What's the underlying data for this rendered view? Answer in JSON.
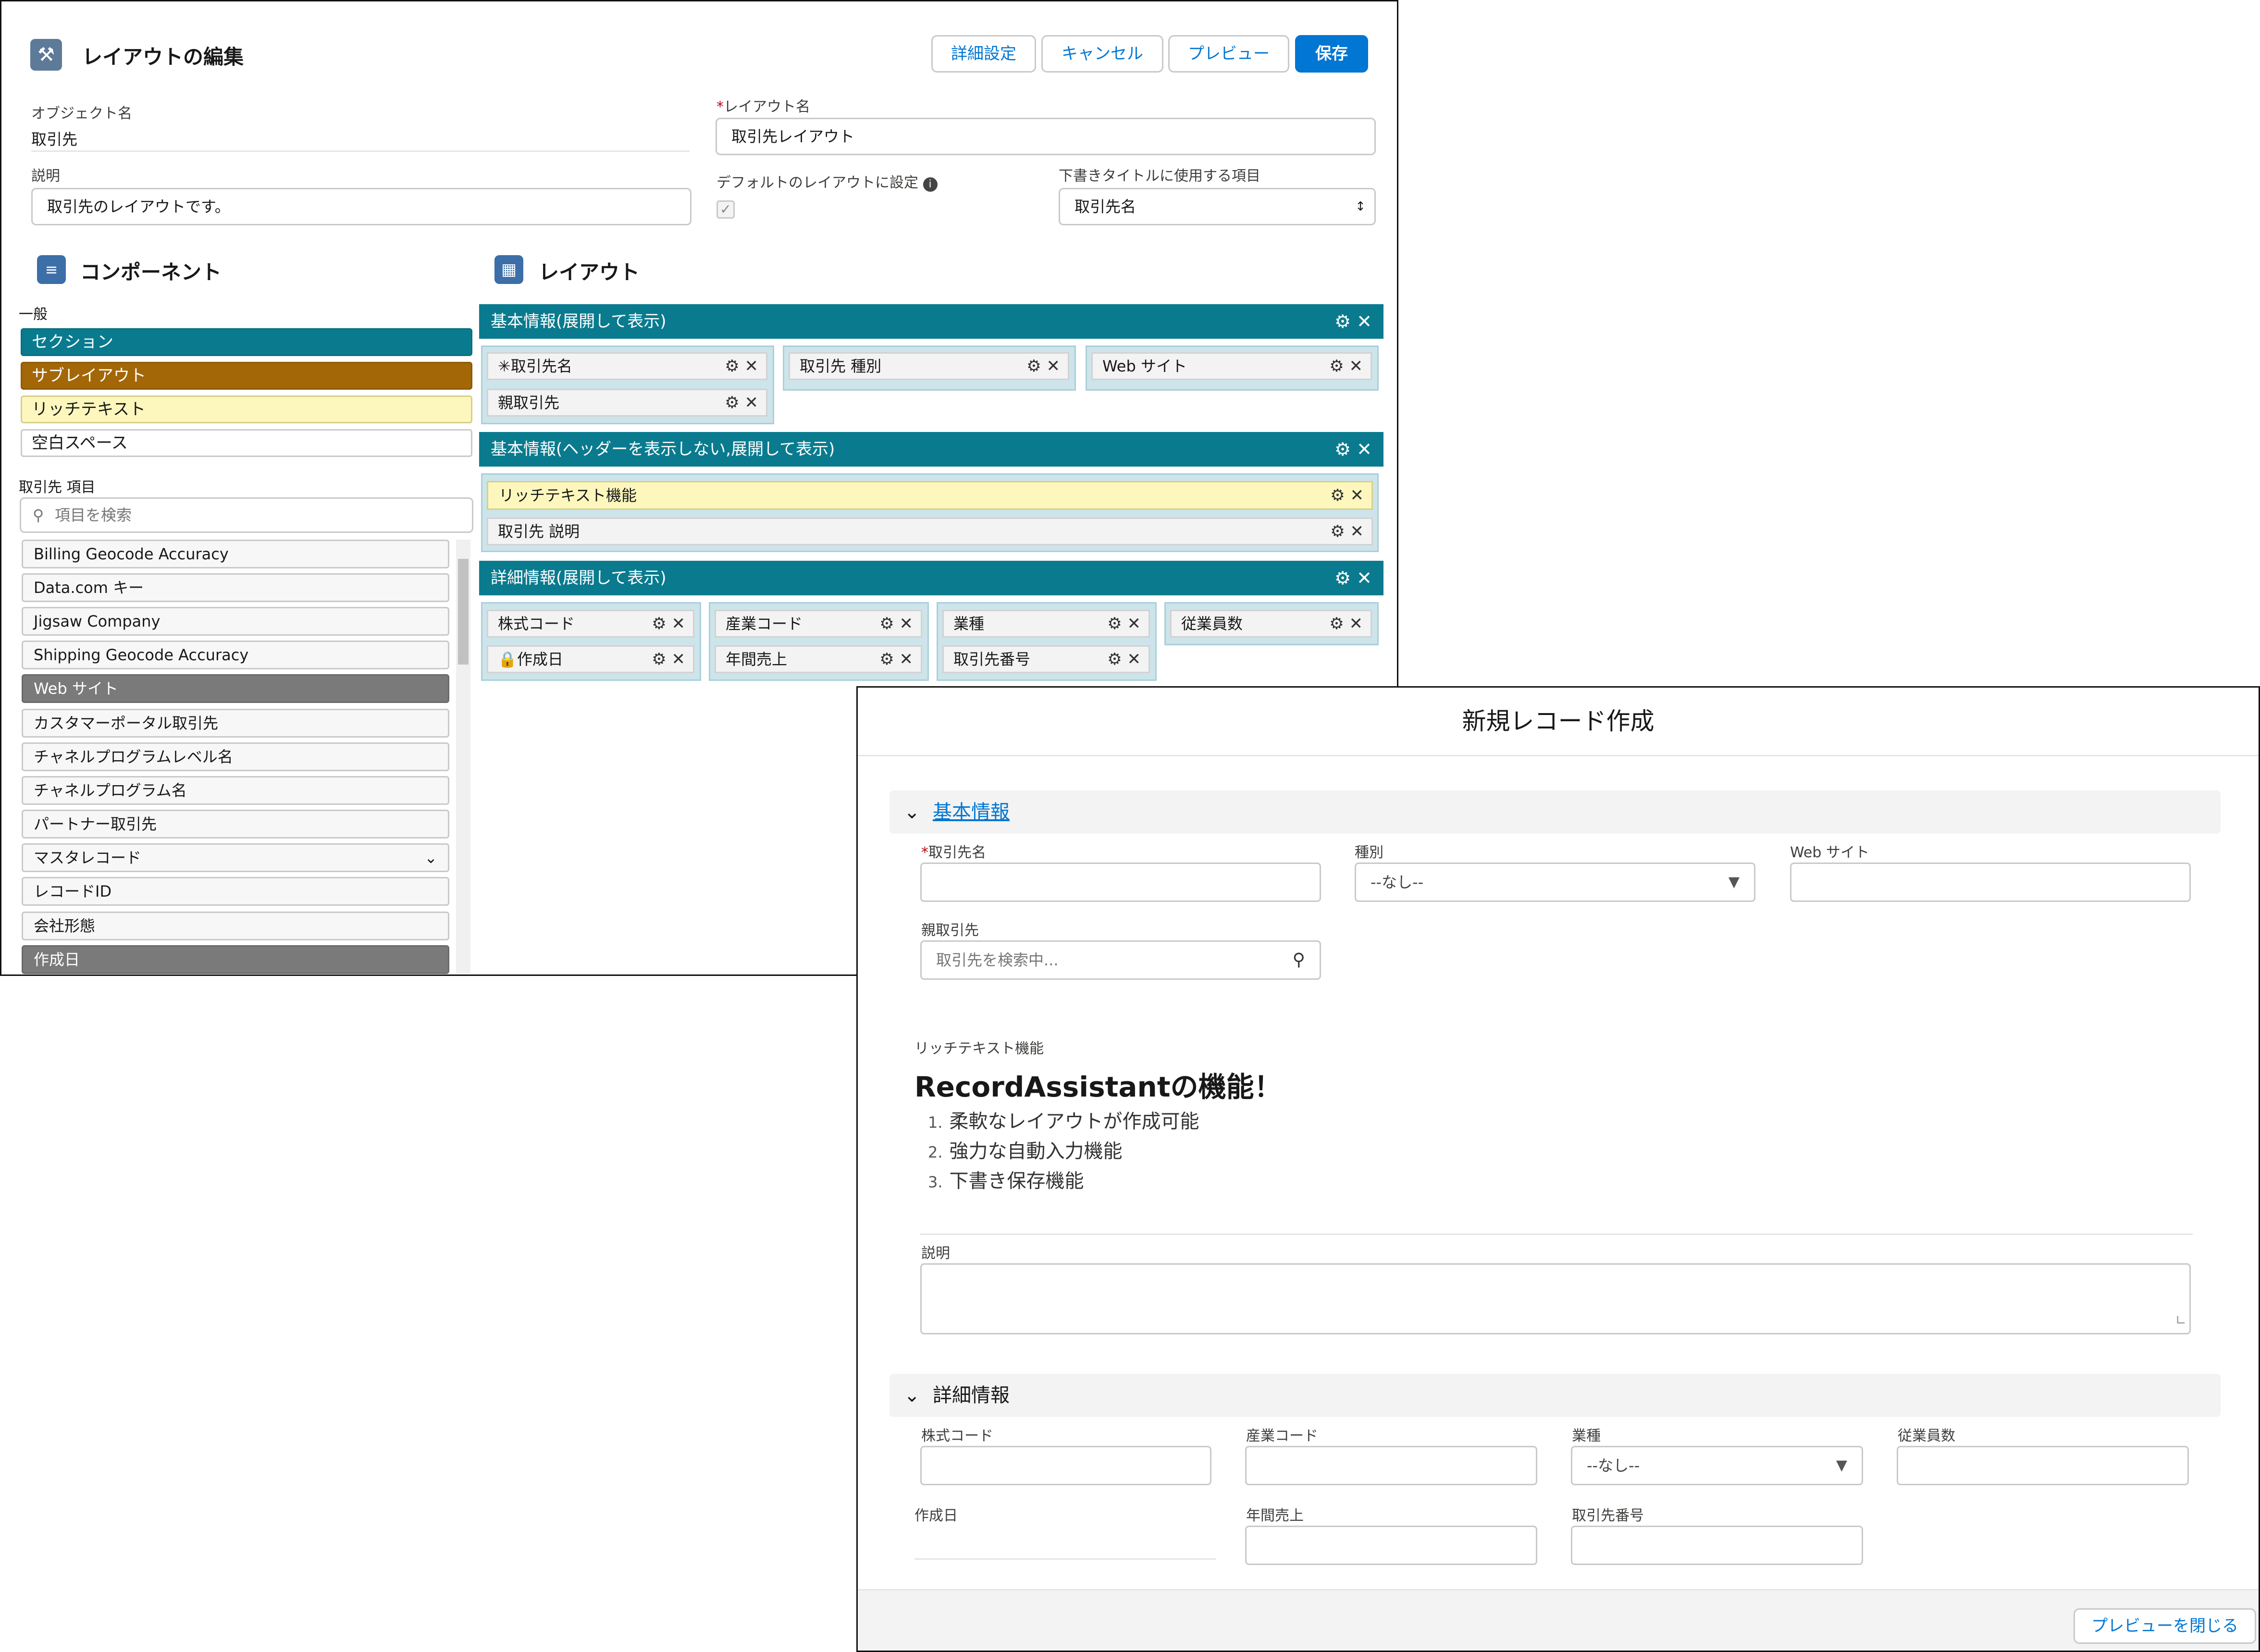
{
  "editor": {
    "title": "レイアウトの編集",
    "buttons": {
      "advanced": "詳細設定",
      "cancel": "キャンセル",
      "preview": "プレビュー",
      "save": "保存"
    },
    "object_name_label": "オブジェクト名",
    "object_name_value": "取引先",
    "layout_name_label": "レイアウト名",
    "layout_name_value": "取引先レイアウト",
    "description_label": "説明",
    "description_value": "取引先のレイアウトです。",
    "default_layout_label": "デフォルトのレイアウトに設定",
    "draft_title_label": "下書きタイトルに使用する項目",
    "draft_title_value": "取引先名",
    "components_title": "コンポーネント",
    "layout_title": "レイアウト",
    "general_label": "一般",
    "general_items": [
      "セクション",
      "サブレイアウト",
      "リッチテキスト",
      "空白スペース"
    ],
    "fields_label": "取引先 項目",
    "search_placeholder": "項目を検索",
    "fields": [
      "Billing Geocode Accuracy",
      "Data.com キー",
      "Jigsaw Company",
      "Shipping Geocode Accuracy",
      "Web サイト",
      "カスタマーポータル取引先",
      "チャネルプログラムレベル名",
      "チャネルプログラム名",
      "パートナー取引先",
      "マスタレコード",
      "レコードID",
      "会社形態",
      "作成日"
    ],
    "sections": [
      {
        "title": "基本情報(展開して表示)",
        "fields": [
          "取引先名",
          "親取引先",
          "取引先 種別",
          "Web サイト"
        ]
      },
      {
        "title": "基本情報(ヘッダーを表示しない,展開して表示)",
        "fields": [
          "リッチテキスト機能",
          "取引先 説明"
        ]
      },
      {
        "title": "詳細情報(展開して表示)",
        "fields": [
          "株式コード",
          "作成日",
          "産業コード",
          "年間売上",
          "業種",
          "取引先番号",
          "従業員数"
        ]
      }
    ]
  },
  "preview": {
    "title": "新規レコード作成",
    "section1": "基本情報",
    "account_name_label": "取引先名",
    "type_label": "種別",
    "type_value": "--なし--",
    "website_label": "Web サイト",
    "parent_label": "親取引先",
    "parent_placeholder": "取引先を検索中...",
    "richtext_label": "リッチテキスト機能",
    "richtext_heading": "RecordAssistantの機能！",
    "richtext_items": [
      "柔軟なレイアウトが作成可能",
      "強力な自動入力機能",
      "下書き保存機能"
    ],
    "description_label": "説明",
    "section2": "詳細情報",
    "ticker_label": "株式コード",
    "sic_label": "産業コード",
    "industry_label": "業種",
    "industry_value": "--なし--",
    "employees_label": "従業員数",
    "created_label": "作成日",
    "revenue_label": "年間売上",
    "account_number_label": "取引先番号",
    "close_button": "プレビューを閉じる"
  },
  "colors": {
    "brand": "#0176d3",
    "section": "#0a7b8f",
    "sublayout": "#a36707",
    "rich": "#fdf7bd",
    "used_field": "#7a7a7a"
  }
}
